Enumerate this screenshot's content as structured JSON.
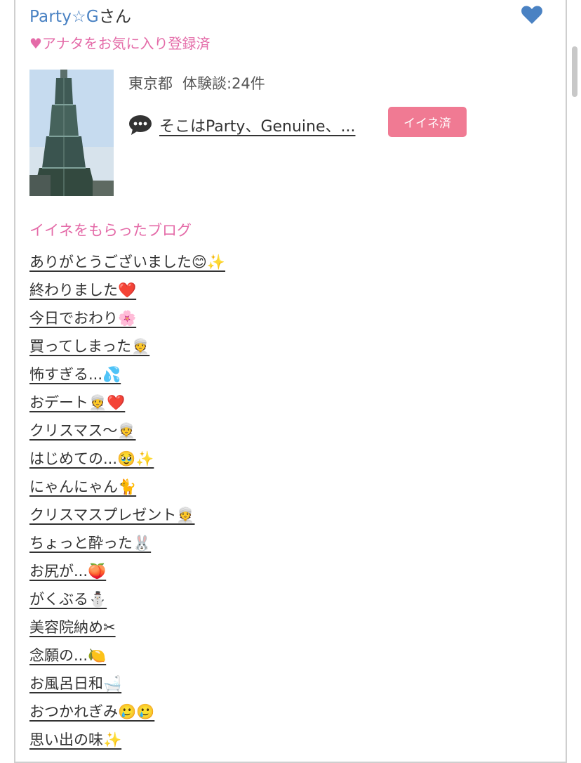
{
  "profile": {
    "name": "Party☆G",
    "name_suffix": "さん",
    "favorite_status": "♥アナタをお気に入り登録済",
    "location": "東京都",
    "experiences": "体験談:24件",
    "comment": "そこはParty、Genuine、...",
    "like_button": "イイネ済"
  },
  "blogs": {
    "heading": "イイネをもらったブログ",
    "items": [
      "ありがとうございました😊✨",
      "終わりました❤️",
      "今日でおわり🌸",
      "買ってしまった👳",
      "怖すぎる...💦",
      "おデート👳❤️",
      "クリスマス〜👳",
      "はじめての...🥹✨",
      "にゃんにゃん🐈",
      "クリスマスプレゼント👳",
      "ちょっと酔った🐰",
      "お尻が...🍑",
      "がくぶる⛄",
      "美容院納め✂",
      "念願の...🍋",
      "お風呂日和🛁",
      "おつかれぎみ🥲🥲",
      "思い出の味✨"
    ]
  },
  "colors": {
    "name_link": "#4a82c3",
    "accent_pink": "#e46ba8",
    "like_button_bg": "#f07a93",
    "heart_blue": "#4a82c3"
  },
  "icons": {
    "favorite": "heart-icon",
    "comment": "speech-bubble-icon"
  }
}
